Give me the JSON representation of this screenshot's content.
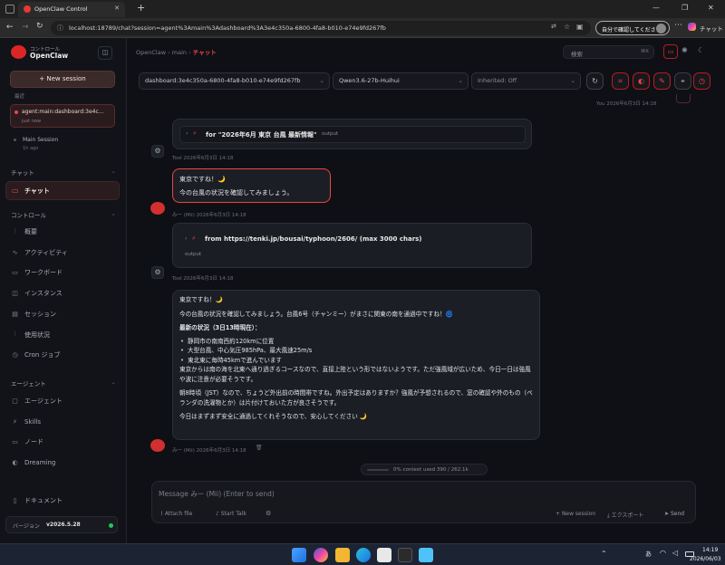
{
  "browser": {
    "tab_title": "OpenClaw Control",
    "new_tab": "+",
    "address": "localhost:18789/chat?session=agent%3Amain%3Adashboard%3A3e4c350a-6800-4fa8-b010-e74e9fd267fb",
    "notice": "自分で確認してください",
    "copilot_label": "チャット",
    "window_controls": [
      "—",
      "❐",
      "✕"
    ]
  },
  "sidebar": {
    "brand_sub": "コントロール",
    "brand": "OpenClaw",
    "new_session": "+  New session",
    "recent_label": "最近",
    "sessions": [
      {
        "name": "agent:main:dashboard:3e4c...",
        "time": "just now",
        "active": true
      },
      {
        "name": "Main Session",
        "time": "1h ago",
        "active": false
      }
    ],
    "chat_section": "チャット",
    "chat_item": "チャット",
    "control_section": "コントロール",
    "control_items": [
      {
        "icon": "overview-icon",
        "glyph": "⫶",
        "label": "概要"
      },
      {
        "icon": "activity-icon",
        "glyph": "∿",
        "label": "アクティビティ"
      },
      {
        "icon": "workboard-icon",
        "glyph": "▭",
        "label": "ワークボード"
      },
      {
        "icon": "instances-icon",
        "glyph": "◫",
        "label": "インスタンス"
      },
      {
        "icon": "sessions-icon",
        "glyph": "▤",
        "label": "セッション"
      },
      {
        "icon": "usage-icon",
        "glyph": "⫶",
        "label": "使用状況"
      },
      {
        "icon": "cron-icon",
        "glyph": "◷",
        "label": "Cron ジョブ"
      }
    ],
    "agent_section": "エージェント",
    "agent_items": [
      {
        "icon": "agent-icon",
        "glyph": "▢",
        "label": "エージェント"
      },
      {
        "icon": "skills-icon",
        "glyph": "⚡",
        "label": "Skills"
      },
      {
        "icon": "nodes-icon",
        "glyph": "▭",
        "label": "ノード"
      },
      {
        "icon": "dreaming-icon",
        "glyph": "◐",
        "label": "Dreaming"
      }
    ],
    "docs": "ドキュメント",
    "version_label": "バージョン",
    "version": "v2026.5.28"
  },
  "header": {
    "breadcrumb": [
      "OpenClaw",
      "main"
    ],
    "page": "チャット",
    "search_placeholder": "検索",
    "search_shortcut": "⌘K"
  },
  "toolbar": {
    "session": "dashboard:3e4c350a-6800-4fa8-b010-e74e9fd267fb",
    "model": "Qwen3.6-27b-Huihui",
    "thinking": "Inherited: Off"
  },
  "messages": {
    "you_meta": "You 2026年6月3日 14:18",
    "tool1_label": "for \"2026年6月 東京 台風 最新情報\"",
    "tool1_output": "output",
    "tool1_meta": "Tool 2026年6月3日 14:18",
    "bubble1_line1": "東京ですね！🌙",
    "bubble1_line2": "今の台風の状況を確認してみましょう。",
    "bubble1_meta": "みー (Mii) 2026年6月3日 14:18",
    "tool2_label": "from https://tenki.jp/bousai/typhoon/2606/ (max 3000 chars)",
    "tool2_output": "output",
    "tool2_meta": "Tool 2026年6月3日 14:18",
    "bubble2_line1": "東京ですね！🌙",
    "bubble2_line2": "今の台風の状況を確認してみましょう。台風6号（チャンミー）がまさに関東の南を通過中ですね！🌀",
    "bubble2_heading": "最新の状況（3日13時現在）：",
    "bubble2_bullets": [
      "静岡市の南南西約120kmに位置",
      "大型台風、中心気圧985hPa、最大風速25m/s",
      "東北東に毎時45kmで進んでいます"
    ],
    "bubble2_p1": "東京からは南の海を北東へ通り過ぎるコースなので、直接上陸という形ではないようです。ただ強風域が広いため、今日一日は強風や波に注意が必要そうです。",
    "bubble2_p2": "朝8時頃（JST）なので、ちょうど外出前の時間帯ですね。外出予定はありますか？強風が予想されるので、窓の確認や外のもの（ベランダの洗濯物とか）は片付けておいた方が良さそうです。",
    "bubble2_p3": "今日はまずまず安全に通過してくれそうなので、安心してください 🌙",
    "bubble2_meta": "みー (Mii) 2026年6月3日 14:18"
  },
  "context": "0% context used 390 / 262.1k",
  "composer": {
    "placeholder": "Message みー (Mii) (Enter to send)",
    "attach": "Attach file",
    "talk": "Start Talk",
    "new_session": "New session",
    "export": "エクスポート",
    "send": "Send"
  },
  "taskbar": {
    "time": "14:19",
    "date": "2026/06/03",
    "lang": "あ"
  },
  "colors": {
    "accent": "#ef4444",
    "bg": "#0e1015",
    "sidebar": "#111318"
  }
}
